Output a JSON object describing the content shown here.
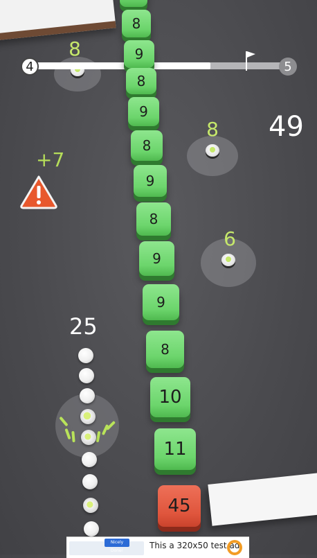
{
  "level": {
    "current": "4",
    "next": "5",
    "progress_fraction": 0.7
  },
  "score": "49",
  "blocks": [
    {
      "value": "8"
    },
    {
      "value": "8"
    },
    {
      "value": "9"
    },
    {
      "value": "8"
    },
    {
      "value": "9"
    },
    {
      "value": "8"
    },
    {
      "value": "9"
    },
    {
      "value": "8"
    },
    {
      "value": "9"
    },
    {
      "value": "8"
    },
    {
      "value": "9"
    },
    {
      "value": "10"
    },
    {
      "value": "11"
    },
    {
      "value": "45"
    }
  ],
  "pickups": [
    {
      "value": "8"
    },
    {
      "value": "8"
    },
    {
      "value": "6"
    }
  ],
  "bonus": {
    "text": "+7",
    "icon": "warning-icon"
  },
  "snake": {
    "length": "25"
  },
  "ad": {
    "text": "This a 320x50 test ad",
    "badge": "Nicely Done!"
  },
  "colors": {
    "block": "#74d874",
    "red_block": "#e25c42",
    "accent": "#c6e86b",
    "warning": "#e8582d"
  }
}
